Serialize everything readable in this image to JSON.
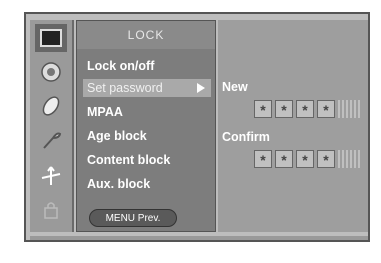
{
  "menu": {
    "title": "LOCK",
    "items": [
      {
        "label": "Lock on/off"
      },
      {
        "label": "Set password"
      },
      {
        "label": "MPAA"
      },
      {
        "label": "Age block"
      },
      {
        "label": "Content block"
      },
      {
        "label": "Aux. block"
      }
    ],
    "selected_index": 1,
    "footer_button": "MENU  Prev."
  },
  "password": {
    "new_label": "New",
    "confirm_label": "Confirm",
    "mask_char": "*",
    "new_digits": [
      "*",
      "*",
      "*",
      "*"
    ],
    "confirm_digits": [
      "*",
      "*",
      "*",
      "*"
    ]
  },
  "icons": [
    "picture-icon",
    "audio-icon",
    "time-icon",
    "option-icon",
    "setup-icon",
    "lock-icon"
  ],
  "colors": {
    "panel": "#7d7d7d",
    "selected": "#a9a9a9",
    "frame": "#bdbdbd"
  }
}
